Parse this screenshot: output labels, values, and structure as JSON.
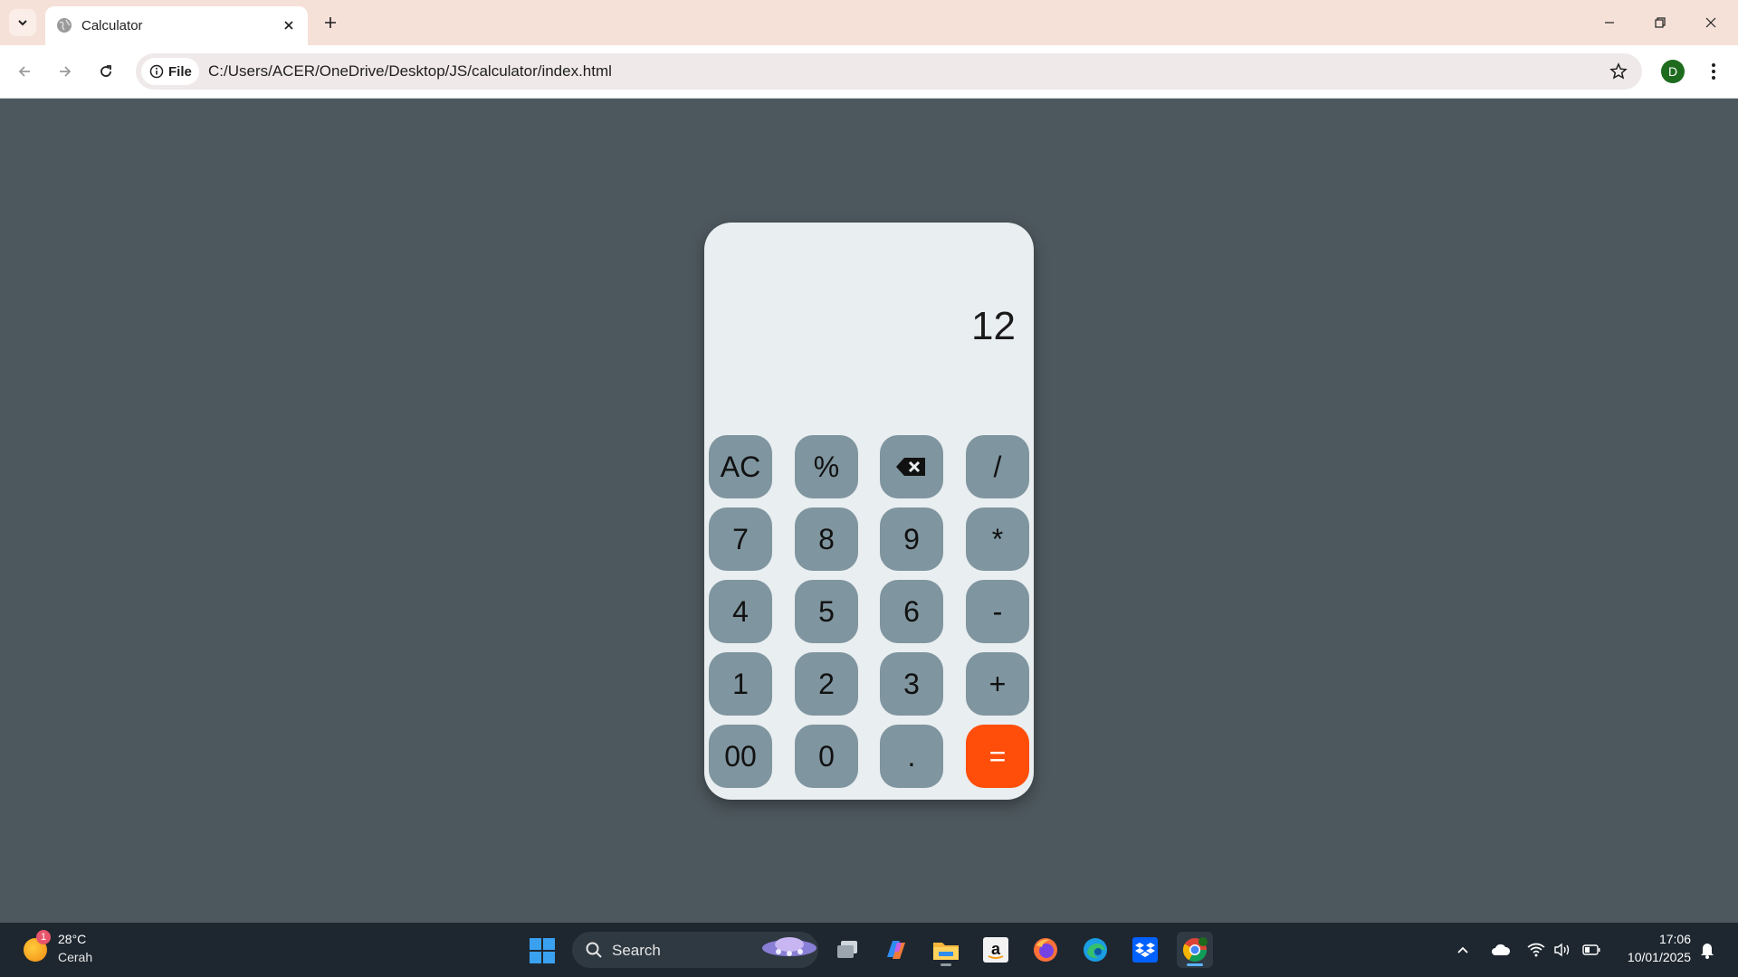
{
  "browser": {
    "tab": {
      "title": "Calculator",
      "favicon": "globe-icon"
    },
    "address": {
      "chip_label": "File",
      "url": "C:/Users/ACER/OneDrive/Desktop/JS/calculator/index.html"
    },
    "profile_initial": "D"
  },
  "calculator": {
    "display": "12",
    "keys": [
      "AC",
      "%",
      "⌫",
      "/",
      "7",
      "8",
      "9",
      "*",
      "4",
      "5",
      "6",
      "-",
      "1",
      "2",
      "3",
      "+",
      "00",
      "0",
      ".",
      "="
    ],
    "colors": {
      "key": "#7f959f",
      "equals": "#ff4d0a",
      "body": "#e9eef0",
      "page": "#4d585e"
    }
  },
  "taskbar": {
    "weather": {
      "badge": "1",
      "temp": "28°C",
      "condition": "Cerah"
    },
    "search_label": "Search",
    "apps": [
      "task-view",
      "copilot",
      "file-explorer",
      "amazon",
      "firefox",
      "edge",
      "dropbox",
      "chrome"
    ],
    "clock": {
      "time": "17:06",
      "date": "10/01/2025"
    }
  }
}
